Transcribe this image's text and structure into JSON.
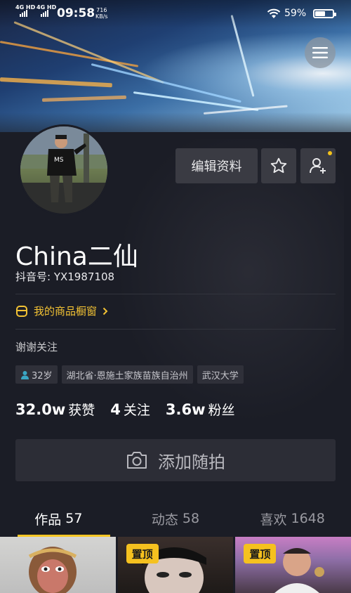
{
  "status_bar": {
    "network_1": "4G HD",
    "network_2": "4G HD",
    "time": "09:58",
    "speed_value": "716",
    "speed_unit": "KB/s",
    "battery_percent": "59%"
  },
  "profile": {
    "nickname": "China二仙",
    "douyin_id": "抖音号: YX1987108",
    "edit_label": "编辑资料",
    "shop_label": "我的商品橱窗",
    "bio": "谢谢关注",
    "tags": {
      "age": "32岁",
      "location": "湖北省·恩施土家族苗族自治州",
      "school": "武汉大学"
    },
    "stats": {
      "likes_num": "32.0w",
      "likes_label": "获赞",
      "following_num": "4",
      "following_label": "关注",
      "fans_num": "3.6w",
      "fans_label": "粉丝"
    },
    "add_moment_label": "添加随拍"
  },
  "tabs": [
    {
      "label": "作品",
      "count": "57"
    },
    {
      "label": "动态",
      "count": "58"
    },
    {
      "label": "喜欢",
      "count": "1648"
    }
  ],
  "grid": {
    "pin_label": "置顶"
  },
  "colors": {
    "accent": "#f7c624",
    "background": "#1b1d26"
  }
}
